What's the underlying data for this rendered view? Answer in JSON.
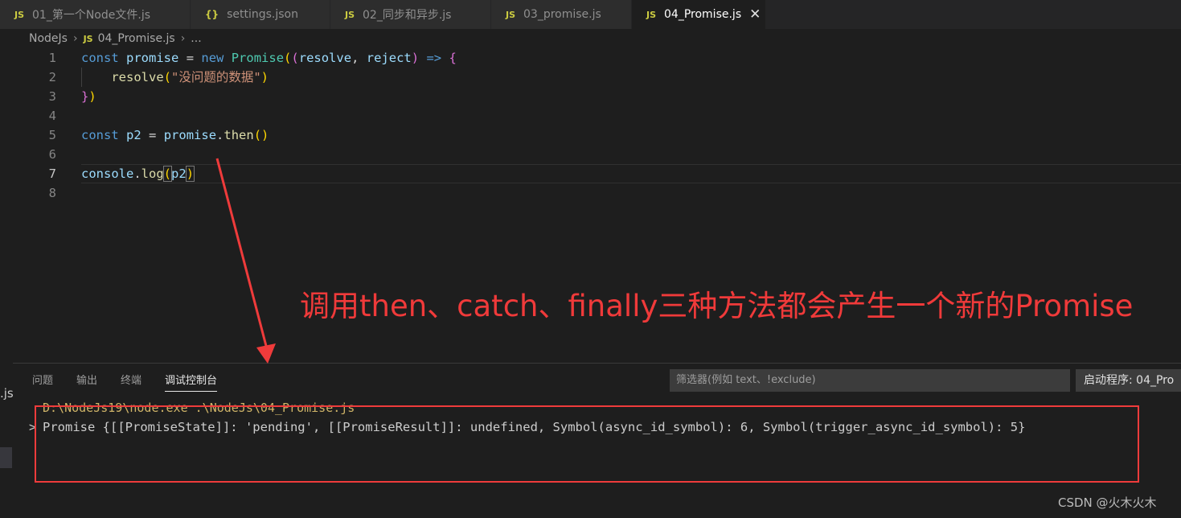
{
  "tabs": [
    {
      "icon": "JS",
      "label": "01_第一个Node文件.js",
      "active": false
    },
    {
      "icon": "{}",
      "label": "settings.json",
      "active": false
    },
    {
      "icon": "JS",
      "label": "02_同步和异步.js",
      "active": false
    },
    {
      "icon": "JS",
      "label": "03_promise.js",
      "active": false
    },
    {
      "icon": "JS",
      "label": "04_Promise.js",
      "active": true
    }
  ],
  "tab_close": "✕",
  "breadcrumb": {
    "folder": "NodeJs",
    "file_icon": "JS",
    "file": "04_Promise.js",
    "more": "..."
  },
  "editor": {
    "line_numbers": [
      "1",
      "2",
      "3",
      "4",
      "5",
      "6",
      "7",
      "8"
    ],
    "current_line": 7
  },
  "annotation": {
    "text": "调用then、catch、finally三种方法都会产生一个新的Promise",
    "color": "#f03a3a"
  },
  "panel": {
    "tabs": [
      "问题",
      "输出",
      "终端",
      "调试控制台"
    ],
    "active_tab": "调试控制台",
    "filter_placeholder": "筛选器(例如 text、!exclude)",
    "launch_label": "启动程序: 04_Pro",
    "command_line": "D:\\NodeJs19\\node.exe .\\NodeJs\\04_Promise.js",
    "output_chevron": ">",
    "output": "Promise {[[PromiseState]]: 'pending', [[PromiseResult]]: undefined, Symbol(async_id_symbol): 6, Symbol(trigger_async_id_symbol): 5}"
  },
  "left_snip": ".js",
  "watermark": "CSDN @火木火木"
}
